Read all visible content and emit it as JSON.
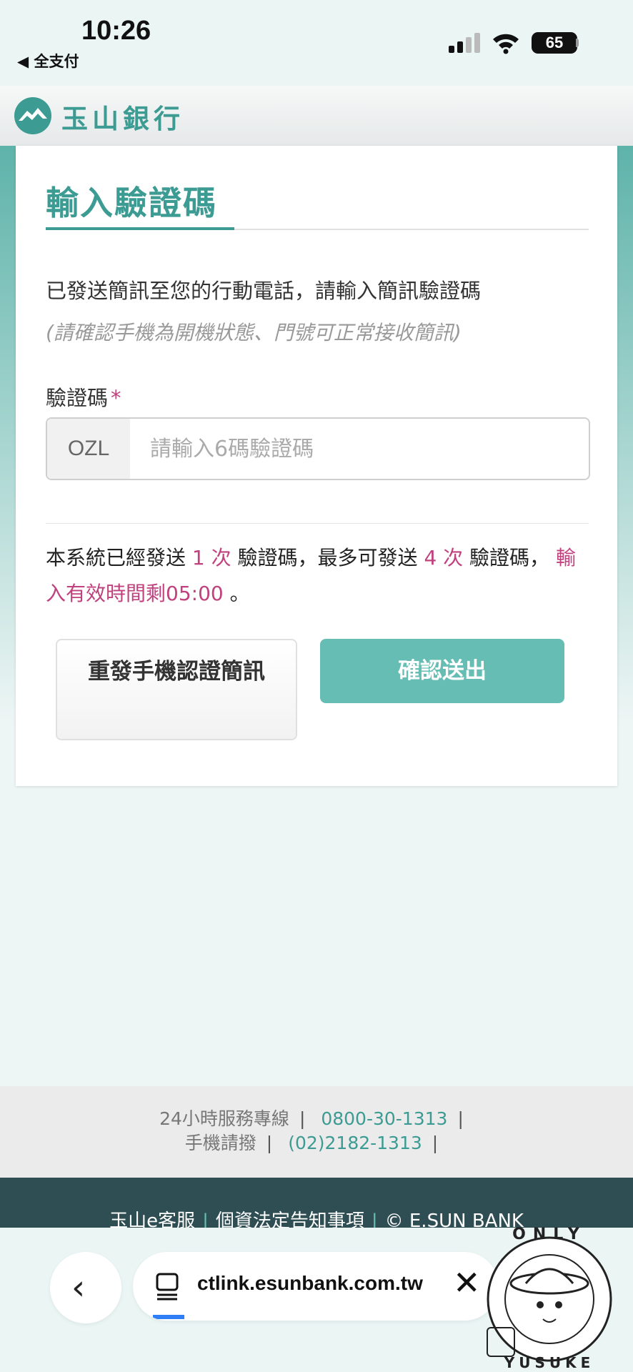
{
  "status": {
    "time": "10:26",
    "back_app": "◀ 全支付",
    "battery": "65"
  },
  "header": {
    "bank_name": "玉山銀行"
  },
  "form": {
    "title": "輸入驗證碼",
    "description": "已發送簡訊至您的行動電話，請輸入簡訊驗證碼",
    "note": "(請確認手機為開機狀態、門號可正常接收簡訊)",
    "field_label": "驗證碼",
    "required_mark": "*",
    "code_prefix": "OZL",
    "code_placeholder": "請輸入6碼驗證碼",
    "info": {
      "part1": "本系統已經發送 ",
      "sent_count": "1 次",
      "part2": " 驗證碼，最多可發送 ",
      "max_count": "4 次",
      "part3": " 驗證碼，",
      "remaining": "輸入有效時間剩05:00",
      "part4": " 。"
    },
    "resend_label": "重發手機認證簡訊",
    "submit_label": "確認送出"
  },
  "footer": {
    "hotline_label": "24小時服務專線",
    "hotline_number": "0800-30-1313",
    "mobile_label": "手機請撥",
    "mobile_number": "(02)2182-1313",
    "links": [
      "玉山e客服",
      "個資法定告知事項",
      "© E.SUN BANK"
    ]
  },
  "browser": {
    "url": "ctlink.esunbank.com.tw"
  },
  "sticker": {
    "top_text": "ONLY",
    "bottom_text": "YUSUKE"
  },
  "colors": {
    "brand": "#3c9b92",
    "button": "#66bdb4",
    "highlight": "#c0417e",
    "footer_dark": "#2f4e53"
  }
}
